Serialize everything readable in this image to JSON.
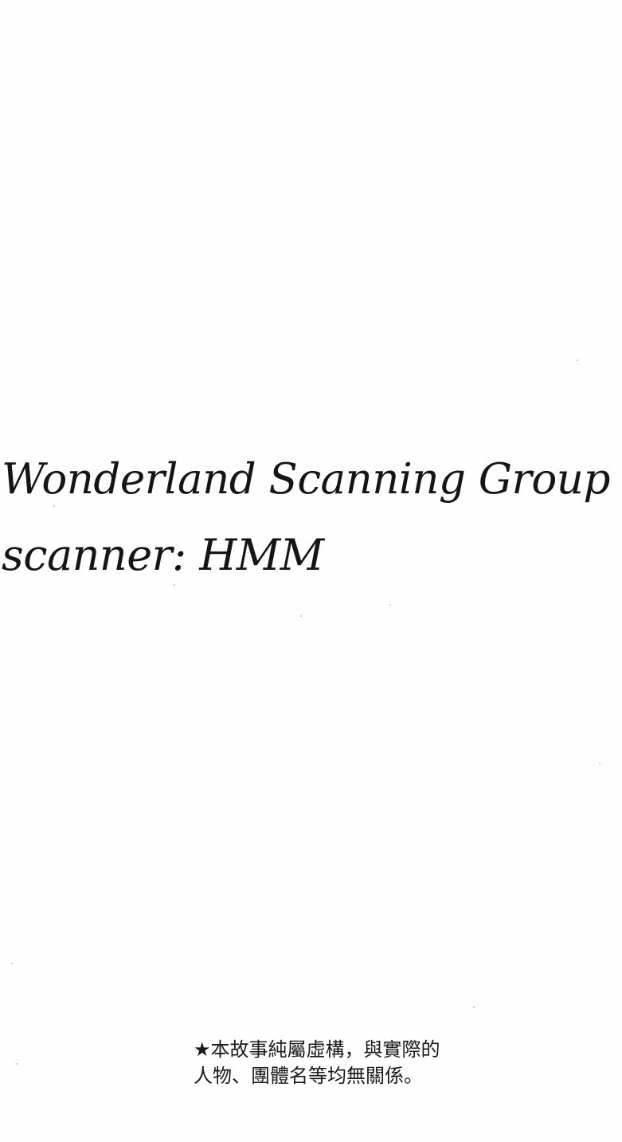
{
  "credits": {
    "group": "Wonderland Scanning Group",
    "scanner": "scanner: HMM"
  },
  "disclaimer": {
    "line1": "★本故事純屬虛構，與實際的",
    "line2": "人物、團體名等均無關係。"
  },
  "colors": {
    "background": "#fefefe",
    "text": "#151515"
  }
}
